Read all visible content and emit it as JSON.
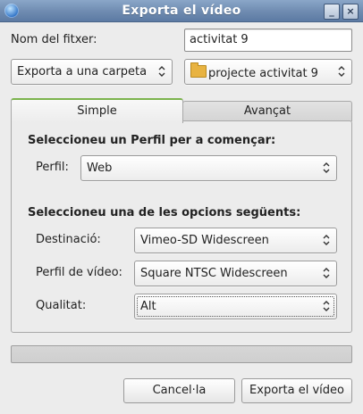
{
  "window": {
    "title": "Exporta el vídeo",
    "minimize_glyph": "_",
    "close_glyph": "×"
  },
  "filename": {
    "label": "Nom del fitxer:",
    "value": "activitat 9"
  },
  "export_type": {
    "selected": "Exporta a una carpeta"
  },
  "folder": {
    "selected": "projecte activitat 9",
    "icon": "folder-icon"
  },
  "tabs": [
    {
      "label": "Simple",
      "active": true
    },
    {
      "label": "Avançat",
      "active": false
    }
  ],
  "simple": {
    "profile_heading": "Seleccioneu un Perfil per a començar:",
    "profile_label": "Perfil:",
    "profile_value": "Web",
    "options_heading": "Seleccioneu una de les opcions següents:",
    "destination_label": "Destinació:",
    "destination_value": "Vimeo-SD Widescreen",
    "video_profile_label": "Perfil de vídeo:",
    "video_profile_value": "Square NTSC Widescreen",
    "quality_label": "Qualitat:",
    "quality_value": "Alt"
  },
  "progress": {
    "fraction": 0
  },
  "buttons": {
    "cancel": "Cancel·la",
    "export": "Exporta el vídeo"
  },
  "colors": {
    "accent": "#7bb34d",
    "titlebar": "#6e8bb0"
  }
}
